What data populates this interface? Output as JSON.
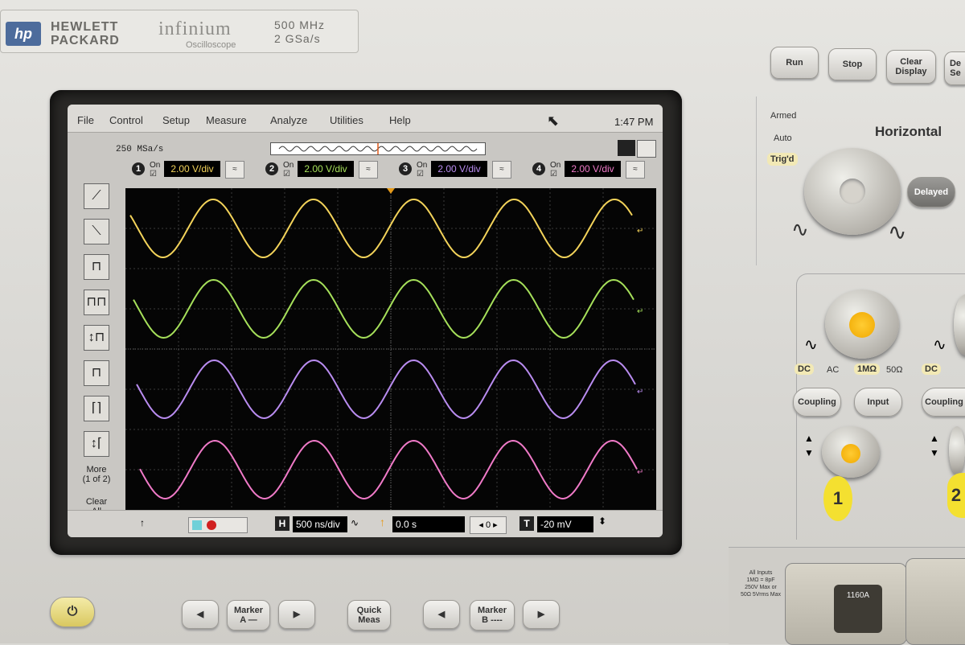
{
  "brand": {
    "logo": "hp",
    "name_line1": "HEWLETT",
    "name_line2": "PACKARD",
    "product": "infinium",
    "product_sub": "Oscilloscope",
    "bandwidth": "500 MHz",
    "sample_rate_spec": "2 GSa/s"
  },
  "menu": {
    "items": [
      "File",
      "Control",
      "Setup",
      "Measure",
      "Analyze",
      "Utilities",
      "Help"
    ],
    "clock": "1:47 PM"
  },
  "acquisition": {
    "sample_rate": "250 MSa/s"
  },
  "channels": [
    {
      "num": "1",
      "on_label": "On",
      "scale": "2.00 V/div",
      "color": "#f3d35a"
    },
    {
      "num": "2",
      "on_label": "On",
      "scale": "2.00 V/div",
      "color": "#a6e05a"
    },
    {
      "num": "3",
      "on_label": "On",
      "scale": "2.00 V/div",
      "color": "#b98cf0"
    },
    {
      "num": "4",
      "on_label": "On",
      "scale": "2.00 V/div",
      "color": "#f07ac8"
    }
  ],
  "toolbar": {
    "more": "More\n(1 of 2)",
    "clear": "Clear\nAll"
  },
  "bottom": {
    "horizontal_icon": "H",
    "timebase": "500 ns/div",
    "delay": "0.0 s",
    "delay_step": "0",
    "trigger_icon": "T",
    "trigger_level": "-20 mV"
  },
  "front_panel": {
    "run": "Run",
    "stop": "Stop",
    "clear_display": "Clear\nDisplay",
    "default_setup": "De\nSe",
    "armed": "Armed",
    "auto": "Auto",
    "trigd": "Trig'd",
    "horizontal": "Horizontal",
    "delayed": "Delayed",
    "dc": "DC",
    "ac": "AC",
    "one_mohm": "1MΩ",
    "fifty_ohm": "50Ω",
    "dc2": "DC",
    "coupling": "Coupling",
    "input": "Input",
    "coupling2": "Coupling",
    "ch1_badge": "1",
    "ch2_badge": "2",
    "marker_a": "Marker\nA —",
    "quick_meas": "Quick\nMeas",
    "marker_b": "Marker\nB ----",
    "inputs_warning": "All Inputs\n1MΩ = 8pF\n250V Max or\n50Ω 5Vrms Max",
    "probe_label": "1160A"
  },
  "waveforms": {
    "cycles": 5,
    "colors": [
      "#f3d35a",
      "#a6e05a",
      "#b98cf0",
      "#f07ac8"
    ]
  }
}
